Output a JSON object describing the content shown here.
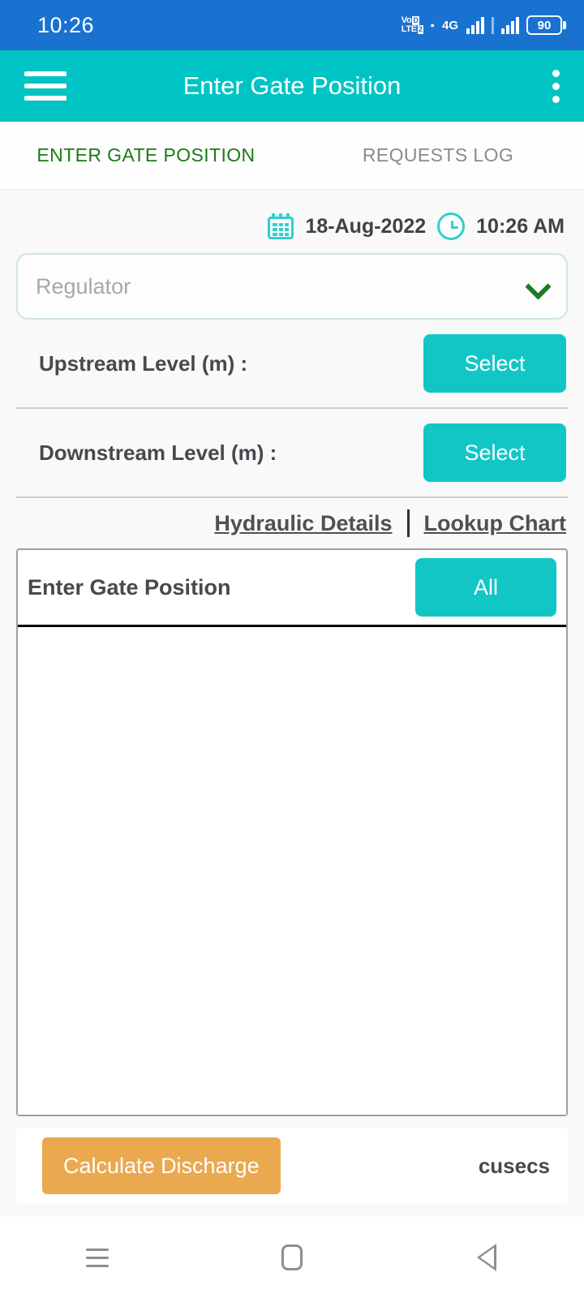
{
  "status_bar": {
    "time": "10:26",
    "volte_line1": "Vo",
    "volte_badge1": "D",
    "volte_line2": "LTE",
    "volte_badge2": "2",
    "network_type": "4G",
    "battery_level": "90",
    "icons": {
      "volte": "volte-icon",
      "signal_primary": "signal-bars-icon",
      "signal_secondary": "signal-bars-icon",
      "battery": "battery-icon"
    },
    "colors": {
      "background": "#1a72d0",
      "foreground": "#ffffff"
    }
  },
  "app_bar": {
    "title": "Enter Gate Position",
    "menu_icon": "hamburger-menu-icon",
    "overflow_icon": "more-vertical-icon",
    "colors": {
      "background": "#00c4c4",
      "foreground": "#ffffff"
    }
  },
  "tabs": [
    {
      "label": "ENTER GATE POSITION",
      "active": true,
      "color": "#1b7a15"
    },
    {
      "label": "REQUESTS LOG",
      "active": false,
      "color": "#8a8a8a"
    }
  ],
  "datetime": {
    "calendar_icon": "calendar-icon",
    "date": "18-Aug-2022",
    "clock_icon": "clock-icon",
    "time": "10:26 AM",
    "icon_color": "#2fcfcf"
  },
  "regulator_dropdown": {
    "placeholder": "Regulator",
    "value": "",
    "chevron_icon": "chevron-down-icon",
    "border_color": "#cfe8d5",
    "chevron_color": "#1e7a25"
  },
  "levels": [
    {
      "label": "Upstream Level (m)  :",
      "button": "Select"
    },
    {
      "label": "Downstream Level (m)  :",
      "button": "Select"
    }
  ],
  "links": [
    {
      "label": "Hydraulic Details"
    },
    {
      "label": "Lookup Chart"
    }
  ],
  "panel": {
    "title": "Enter Gate Position",
    "filter_button": "All",
    "rows": []
  },
  "calculate_bar": {
    "button_label": "Calculate Discharge",
    "unit_label": "cusecs",
    "value": "",
    "button_color": "#eaa94e"
  },
  "nav_bar": {
    "recents_icon": "recents-icon",
    "home_icon": "home-icon",
    "back_icon": "back-icon"
  },
  "theme": {
    "accent_teal": "#12c6c6",
    "app_bar_teal": "#00c4c4",
    "status_blue": "#1a72d0",
    "active_tab_green": "#1b7a15",
    "orange": "#eaa94e",
    "page_background": "#f9f9f9"
  }
}
